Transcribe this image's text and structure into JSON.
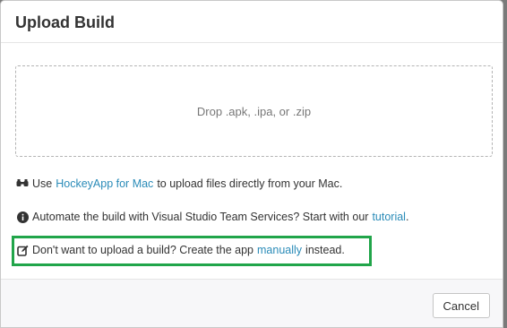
{
  "dialog": {
    "title": "Upload Build"
  },
  "dropzone": {
    "text": "Drop .apk, .ipa, or .zip"
  },
  "info": {
    "mac": {
      "icon": "binoculars-icon",
      "before": "Use",
      "link": "HockeyApp for Mac",
      "after": "to upload files directly from your Mac."
    },
    "automate": {
      "icon": "info-circle-icon",
      "before": "Automate the build with Visual Studio Team Services? Start with our",
      "link": "tutorial",
      "after": "."
    },
    "manual": {
      "icon": "edit-icon",
      "before": "Don't want to upload a build? Create the app",
      "link": "manually",
      "after": "instead."
    }
  },
  "footer": {
    "cancel_label": "Cancel"
  },
  "colors": {
    "link": "#2a8bb8",
    "highlight": "#21a54a",
    "text": "#333333"
  }
}
